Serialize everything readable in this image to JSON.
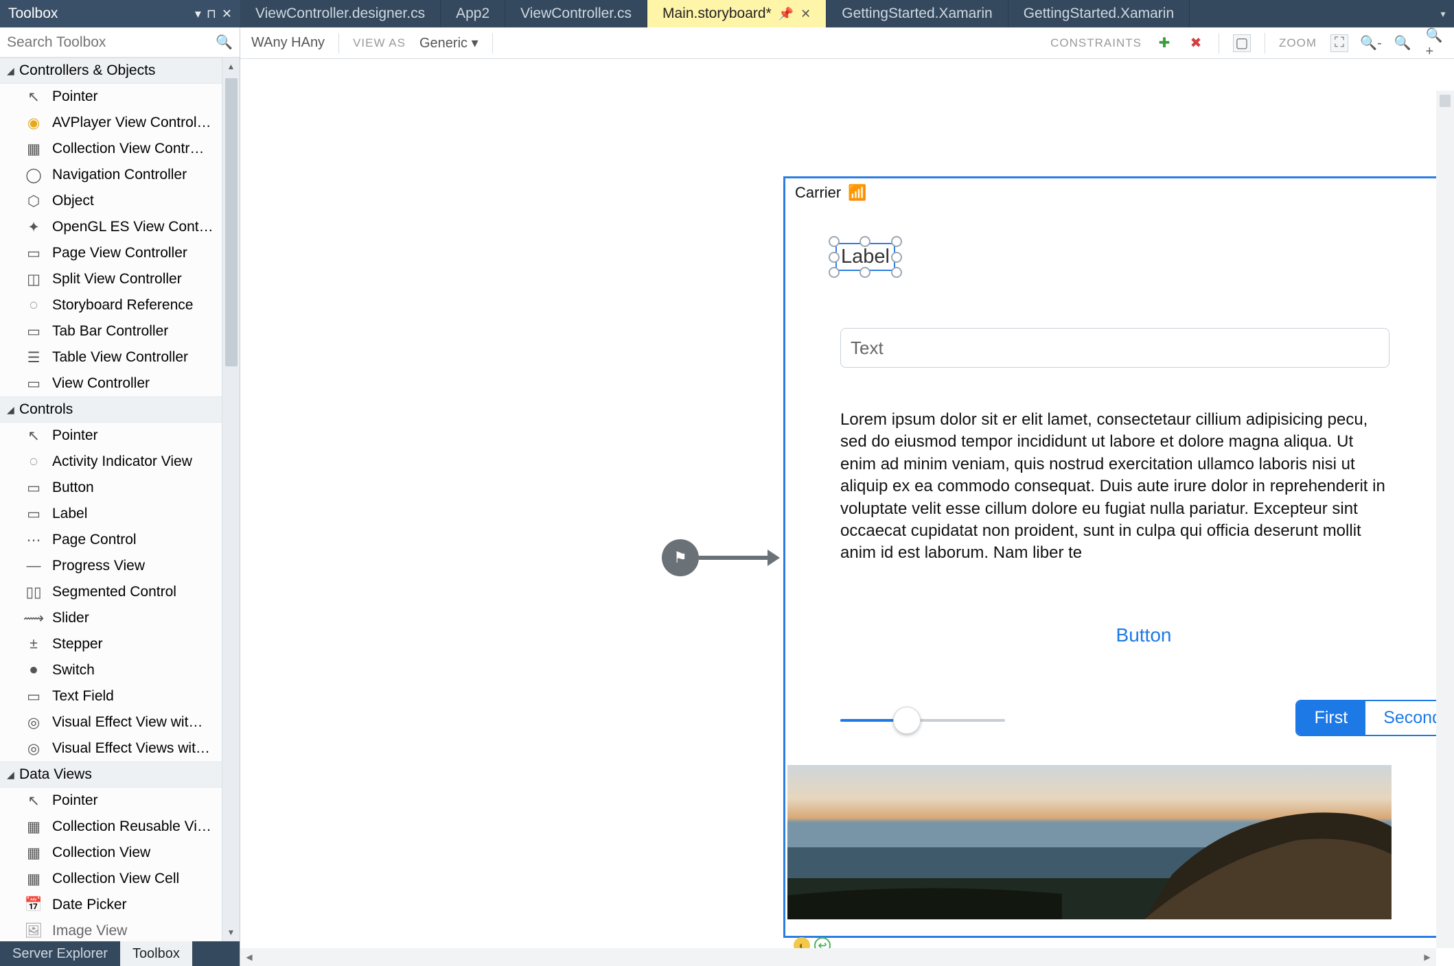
{
  "tabs": [
    {
      "label": "ViewController.designer.cs",
      "active": false,
      "pinned": false,
      "closable": false
    },
    {
      "label": "App2",
      "active": false,
      "pinned": false,
      "closable": false
    },
    {
      "label": "ViewController.cs",
      "active": false,
      "pinned": false,
      "closable": false
    },
    {
      "label": "Main.storyboard*",
      "active": true,
      "pinned": true,
      "closable": true
    },
    {
      "label": "GettingStarted.Xamarin",
      "active": false,
      "pinned": false,
      "closable": false
    },
    {
      "label": "GettingStarted.Xamarin",
      "active": false,
      "pinned": false,
      "closable": false
    }
  ],
  "toolbox": {
    "title": "Toolbox",
    "search_placeholder": "Search Toolbox",
    "categories": [
      {
        "name": "Controllers & Objects",
        "items": [
          "Pointer",
          "AVPlayer View Control…",
          "Collection View Contr…",
          "Navigation Controller",
          "Object",
          "OpenGL ES View Cont…",
          "Page View Controller",
          "Split View Controller",
          "Storyboard Reference",
          "Tab Bar Controller",
          "Table View Controller",
          "View Controller"
        ]
      },
      {
        "name": "Controls",
        "items": [
          "Pointer",
          "Activity Indicator View",
          "Button",
          "Label",
          "Page Control",
          "Progress View",
          "Segmented Control",
          "Slider",
          "Stepper",
          "Switch",
          "Text Field",
          "Visual Effect View wit…",
          "Visual Effect Views wit…"
        ]
      },
      {
        "name": "Data Views",
        "items": [
          "Pointer",
          "Collection Reusable Vi…",
          "Collection View",
          "Collection View Cell",
          "Date Picker",
          "Image View"
        ]
      }
    ]
  },
  "bottom_tabs": {
    "left": "Server Explorer",
    "right": "Toolbox"
  },
  "design_toolbar": {
    "size": "WAny HAny",
    "view_as_label": "VIEW AS",
    "view_as_value": "Generic",
    "constraints_label": "CONSTRAINTS",
    "zoom_label": "ZOOM"
  },
  "phone": {
    "carrier": "Carrier",
    "label_text": "Label",
    "textfield_placeholder": "Text",
    "textview": "Lorem ipsum dolor sit er elit lamet, consectetaur cillium adipisicing pecu, sed do eiusmod tempor incididunt ut labore et dolore magna aliqua. Ut enim ad minim veniam, quis nostrud exercitation ullamco laboris nisi ut aliquip ex ea commodo consequat. Duis aute irure dolor in reprehenderit in voluptate velit esse cillum dolore eu fugiat nulla pariatur. Excepteur sint occaecat cupidatat non proident, sunt in culpa qui officia deserunt mollit anim id est laborum. Nam liber te",
    "button_label": "Button",
    "segment_first": "First",
    "segment_second": "Second"
  }
}
